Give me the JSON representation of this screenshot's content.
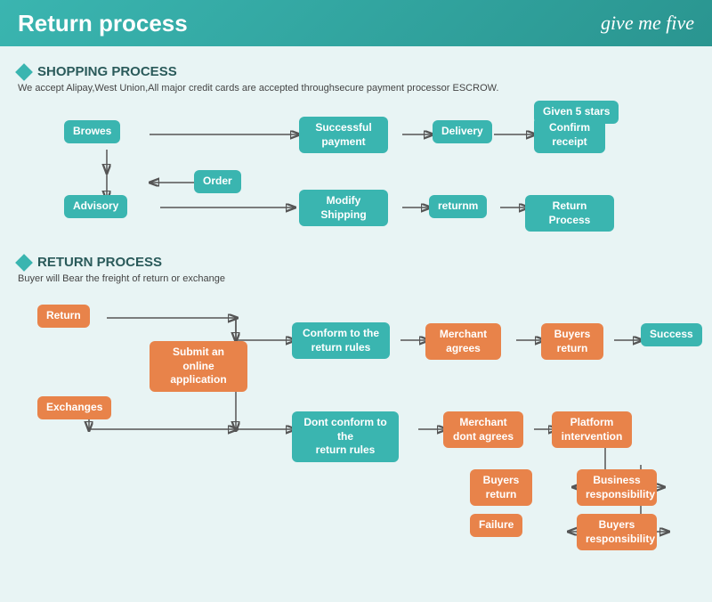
{
  "header": {
    "title": "Return process",
    "logo": "give me five"
  },
  "shopping": {
    "section_title": "SHOPPING PROCESS",
    "description": "We accept Alipay,West Union,All major credit cards are accepted throughsecure payment processor ESCROW.",
    "nodes": {
      "browes": "Browes",
      "order": "Order",
      "advisory": "Advisory",
      "modify_shipping": "Modify\nShipping",
      "returnm": "returnm",
      "return_process": "Return Process",
      "successful_payment": "Successful\npayment",
      "delivery": "Delivery",
      "confirm_receipt": "Confirm\nreceipt",
      "given_5_stars": "Given 5 stars"
    }
  },
  "return": {
    "section_title": "RETURN PROCESS",
    "description": "Buyer will Bear the freight of return or exchange",
    "nodes": {
      "return": "Return",
      "exchanges": "Exchanges",
      "submit_application": "Submit an online\napplication",
      "conform_rules": "Conform to the\nreturn rules",
      "dont_conform_rules": "Dont conform to the\nreturn rules",
      "merchant_agrees": "Merchant\nagrees",
      "merchant_dont_agrees": "Merchant\ndont agrees",
      "buyers_return_1": "Buyers\nreturn",
      "platform_intervention": "Platform\nintervention",
      "success": "Success",
      "buyers_return_2": "Buyers\nreturn",
      "business_responsibility": "Business\nresponsibility",
      "failure": "Failure",
      "buyers_responsibility": "Buyers\nresponsibility"
    }
  }
}
